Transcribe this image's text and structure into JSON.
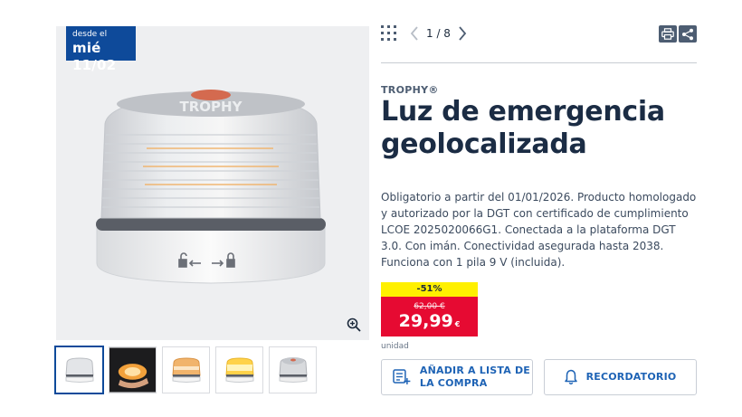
{
  "gallery": {
    "badge": {
      "prefix": "desde el",
      "date": "mié 11/02"
    },
    "product_brand_on_image": "TROPHY",
    "zoom_icon": "zoom-in-icon",
    "thumbnails": [
      {
        "name": "thumb-light-front",
        "active": true
      },
      {
        "name": "thumb-light-in-hand",
        "active": false
      },
      {
        "name": "thumb-light-orange",
        "active": false
      },
      {
        "name": "thumb-light-yellow",
        "active": false
      },
      {
        "name": "thumb-light-top",
        "active": false
      }
    ]
  },
  "pager": {
    "current": 1,
    "total": 8,
    "text": "1 / 8"
  },
  "toolbar": {
    "print_icon": "print-icon",
    "share_icon": "share-icon",
    "grid_icon": "grid-icon"
  },
  "product": {
    "brand": "TROPHY®",
    "title": "Luz de emergencia geolocalizada",
    "description": "Obligatorio a partir del 01/01/2026. Producto homologado y autorizado por la DGT con certificado de cumplimiento LCOE 2025020066G1. Conectada a la plataforma DGT 3.0. Con imán. Conectividad asegurada hasta 2038. Funciona con 1 pila 9 V (incluida)."
  },
  "price": {
    "discount": "-51%",
    "old_price": "62,00 €",
    "current": "29,99",
    "currency": "€",
    "unit": "unidad"
  },
  "actions": {
    "add_to_list": "AÑADIR A LISTA DE LA COMPRA",
    "reminder": "RECORDATORIO"
  },
  "colors": {
    "badge_blue": "#0e4a9a",
    "discount_yellow": "#fff000",
    "price_red": "#e60a32",
    "link_blue": "#1e63b5"
  }
}
